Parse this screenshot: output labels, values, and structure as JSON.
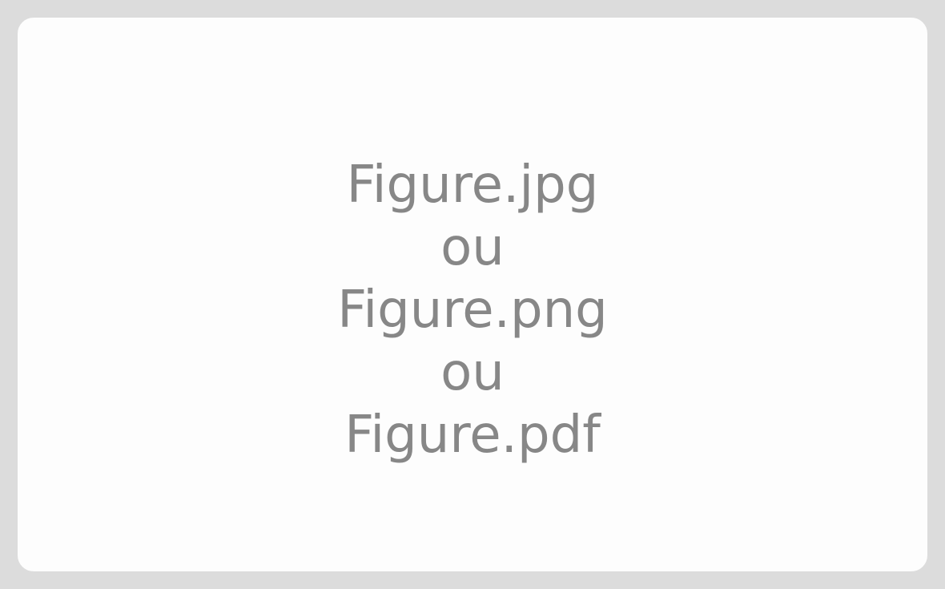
{
  "placeholder": {
    "lines": [
      "Figure.jpg",
      "ou",
      "Figure.png",
      "ou",
      "Figure.pdf"
    ]
  },
  "colors": {
    "border": "#dcdcdc",
    "background": "#fdfdfd",
    "text": "#878787"
  }
}
